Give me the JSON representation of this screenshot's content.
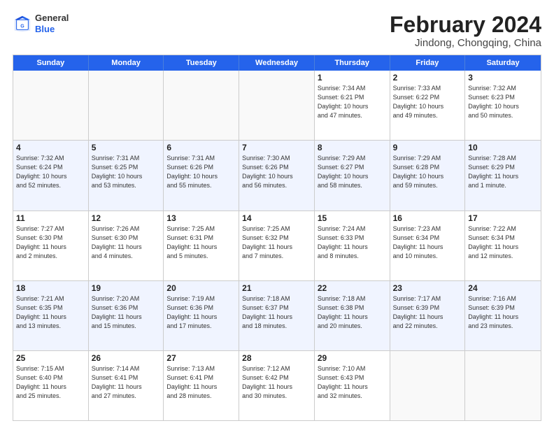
{
  "header": {
    "logo_general": "General",
    "logo_blue": "Blue",
    "main_title": "February 2024",
    "subtitle": "Jindong, Chongqing, China"
  },
  "calendar": {
    "days_of_week": [
      "Sunday",
      "Monday",
      "Tuesday",
      "Wednesday",
      "Thursday",
      "Friday",
      "Saturday"
    ],
    "weeks": [
      {
        "alt": false,
        "cells": [
          {
            "day": "",
            "empty": true,
            "info": ""
          },
          {
            "day": "",
            "empty": true,
            "info": ""
          },
          {
            "day": "",
            "empty": true,
            "info": ""
          },
          {
            "day": "",
            "empty": true,
            "info": ""
          },
          {
            "day": "1",
            "empty": false,
            "info": "Sunrise: 7:34 AM\nSunset: 6:21 PM\nDaylight: 10 hours\nand 47 minutes."
          },
          {
            "day": "2",
            "empty": false,
            "info": "Sunrise: 7:33 AM\nSunset: 6:22 PM\nDaylight: 10 hours\nand 49 minutes."
          },
          {
            "day": "3",
            "empty": false,
            "info": "Sunrise: 7:32 AM\nSunset: 6:23 PM\nDaylight: 10 hours\nand 50 minutes."
          }
        ]
      },
      {
        "alt": true,
        "cells": [
          {
            "day": "4",
            "empty": false,
            "info": "Sunrise: 7:32 AM\nSunset: 6:24 PM\nDaylight: 10 hours\nand 52 minutes."
          },
          {
            "day": "5",
            "empty": false,
            "info": "Sunrise: 7:31 AM\nSunset: 6:25 PM\nDaylight: 10 hours\nand 53 minutes."
          },
          {
            "day": "6",
            "empty": false,
            "info": "Sunrise: 7:31 AM\nSunset: 6:26 PM\nDaylight: 10 hours\nand 55 minutes."
          },
          {
            "day": "7",
            "empty": false,
            "info": "Sunrise: 7:30 AM\nSunset: 6:26 PM\nDaylight: 10 hours\nand 56 minutes."
          },
          {
            "day": "8",
            "empty": false,
            "info": "Sunrise: 7:29 AM\nSunset: 6:27 PM\nDaylight: 10 hours\nand 58 minutes."
          },
          {
            "day": "9",
            "empty": false,
            "info": "Sunrise: 7:29 AM\nSunset: 6:28 PM\nDaylight: 10 hours\nand 59 minutes."
          },
          {
            "day": "10",
            "empty": false,
            "info": "Sunrise: 7:28 AM\nSunset: 6:29 PM\nDaylight: 11 hours\nand 1 minute."
          }
        ]
      },
      {
        "alt": false,
        "cells": [
          {
            "day": "11",
            "empty": false,
            "info": "Sunrise: 7:27 AM\nSunset: 6:30 PM\nDaylight: 11 hours\nand 2 minutes."
          },
          {
            "day": "12",
            "empty": false,
            "info": "Sunrise: 7:26 AM\nSunset: 6:30 PM\nDaylight: 11 hours\nand 4 minutes."
          },
          {
            "day": "13",
            "empty": false,
            "info": "Sunrise: 7:25 AM\nSunset: 6:31 PM\nDaylight: 11 hours\nand 5 minutes."
          },
          {
            "day": "14",
            "empty": false,
            "info": "Sunrise: 7:25 AM\nSunset: 6:32 PM\nDaylight: 11 hours\nand 7 minutes."
          },
          {
            "day": "15",
            "empty": false,
            "info": "Sunrise: 7:24 AM\nSunset: 6:33 PM\nDaylight: 11 hours\nand 8 minutes."
          },
          {
            "day": "16",
            "empty": false,
            "info": "Sunrise: 7:23 AM\nSunset: 6:34 PM\nDaylight: 11 hours\nand 10 minutes."
          },
          {
            "day": "17",
            "empty": false,
            "info": "Sunrise: 7:22 AM\nSunset: 6:34 PM\nDaylight: 11 hours\nand 12 minutes."
          }
        ]
      },
      {
        "alt": true,
        "cells": [
          {
            "day": "18",
            "empty": false,
            "info": "Sunrise: 7:21 AM\nSunset: 6:35 PM\nDaylight: 11 hours\nand 13 minutes."
          },
          {
            "day": "19",
            "empty": false,
            "info": "Sunrise: 7:20 AM\nSunset: 6:36 PM\nDaylight: 11 hours\nand 15 minutes."
          },
          {
            "day": "20",
            "empty": false,
            "info": "Sunrise: 7:19 AM\nSunset: 6:36 PM\nDaylight: 11 hours\nand 17 minutes."
          },
          {
            "day": "21",
            "empty": false,
            "info": "Sunrise: 7:18 AM\nSunset: 6:37 PM\nDaylight: 11 hours\nand 18 minutes."
          },
          {
            "day": "22",
            "empty": false,
            "info": "Sunrise: 7:18 AM\nSunset: 6:38 PM\nDaylight: 11 hours\nand 20 minutes."
          },
          {
            "day": "23",
            "empty": false,
            "info": "Sunrise: 7:17 AM\nSunset: 6:39 PM\nDaylight: 11 hours\nand 22 minutes."
          },
          {
            "day": "24",
            "empty": false,
            "info": "Sunrise: 7:16 AM\nSunset: 6:39 PM\nDaylight: 11 hours\nand 23 minutes."
          }
        ]
      },
      {
        "alt": false,
        "cells": [
          {
            "day": "25",
            "empty": false,
            "info": "Sunrise: 7:15 AM\nSunset: 6:40 PM\nDaylight: 11 hours\nand 25 minutes."
          },
          {
            "day": "26",
            "empty": false,
            "info": "Sunrise: 7:14 AM\nSunset: 6:41 PM\nDaylight: 11 hours\nand 27 minutes."
          },
          {
            "day": "27",
            "empty": false,
            "info": "Sunrise: 7:13 AM\nSunset: 6:41 PM\nDaylight: 11 hours\nand 28 minutes."
          },
          {
            "day": "28",
            "empty": false,
            "info": "Sunrise: 7:12 AM\nSunset: 6:42 PM\nDaylight: 11 hours\nand 30 minutes."
          },
          {
            "day": "29",
            "empty": false,
            "info": "Sunrise: 7:10 AM\nSunset: 6:43 PM\nDaylight: 11 hours\nand 32 minutes."
          },
          {
            "day": "",
            "empty": true,
            "info": ""
          },
          {
            "day": "",
            "empty": true,
            "info": ""
          }
        ]
      }
    ]
  }
}
